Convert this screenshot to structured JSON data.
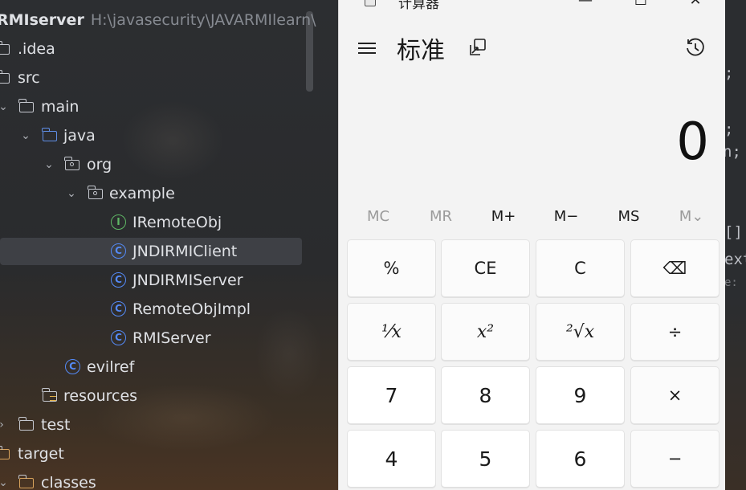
{
  "ide": {
    "project_name": "RMIserver",
    "project_path": "H:\\javasecurity\\JAVARMIlearn\\",
    "tree": [
      {
        "label": ".idea",
        "expanded": false
      },
      {
        "label": "src",
        "expanded": true
      },
      {
        "label": "main",
        "expanded": true
      },
      {
        "label": "java",
        "expanded": true
      },
      {
        "label": "org",
        "expanded": true
      },
      {
        "label": "example",
        "expanded": true
      },
      {
        "label": "IRemoteObj",
        "kind": "interface"
      },
      {
        "label": "JNDIRMIClient",
        "kind": "class",
        "selected": true
      },
      {
        "label": "JNDIRMIServer",
        "kind": "class"
      },
      {
        "label": "RemoteObjImpl",
        "kind": "class"
      },
      {
        "label": "RMIServer",
        "kind": "class"
      },
      {
        "label": "evilref",
        "kind": "class"
      },
      {
        "label": "resources",
        "kind": "resources"
      },
      {
        "label": "test",
        "expanded": false
      },
      {
        "label": "target",
        "expanded": true
      },
      {
        "label": "classes",
        "expanded": true
      }
    ],
    "icon_letters": {
      "class": "C",
      "interface": "I"
    }
  },
  "editor_fragments": [
    ";",
    ";",
    "n;",
    "[]",
    "ext",
    "e:"
  ],
  "calculator": {
    "app_title": "计算器",
    "mode": "标准",
    "display": "0",
    "window_buttons": {
      "minimize": "—",
      "maximize": "☐",
      "close": "✕"
    },
    "memory": [
      {
        "label": "MC",
        "enabled": false
      },
      {
        "label": "MR",
        "enabled": false
      },
      {
        "label": "M+",
        "enabled": true
      },
      {
        "label": "M−",
        "enabled": true
      },
      {
        "label": "MS",
        "enabled": true
      },
      {
        "label": "M⌄",
        "enabled": false
      }
    ],
    "keys": [
      {
        "label": "%",
        "name": "percent-key"
      },
      {
        "label": "CE",
        "name": "clear-entry-key"
      },
      {
        "label": "C",
        "name": "clear-key"
      },
      {
        "label": "⌫",
        "name": "backspace-key"
      },
      {
        "label": "⅟x",
        "name": "reciprocal-key"
      },
      {
        "label": "x²",
        "name": "square-key"
      },
      {
        "label": "²√x",
        "name": "square-root-key"
      },
      {
        "label": "÷",
        "name": "divide-key"
      },
      {
        "label": "7",
        "name": "digit-7-key"
      },
      {
        "label": "8",
        "name": "digit-8-key"
      },
      {
        "label": "9",
        "name": "digit-9-key"
      },
      {
        "label": "×",
        "name": "multiply-key"
      },
      {
        "label": "4",
        "name": "digit-4-key"
      },
      {
        "label": "5",
        "name": "digit-5-key"
      },
      {
        "label": "6",
        "name": "digit-6-key"
      },
      {
        "label": "−",
        "name": "subtract-key"
      }
    ]
  }
}
